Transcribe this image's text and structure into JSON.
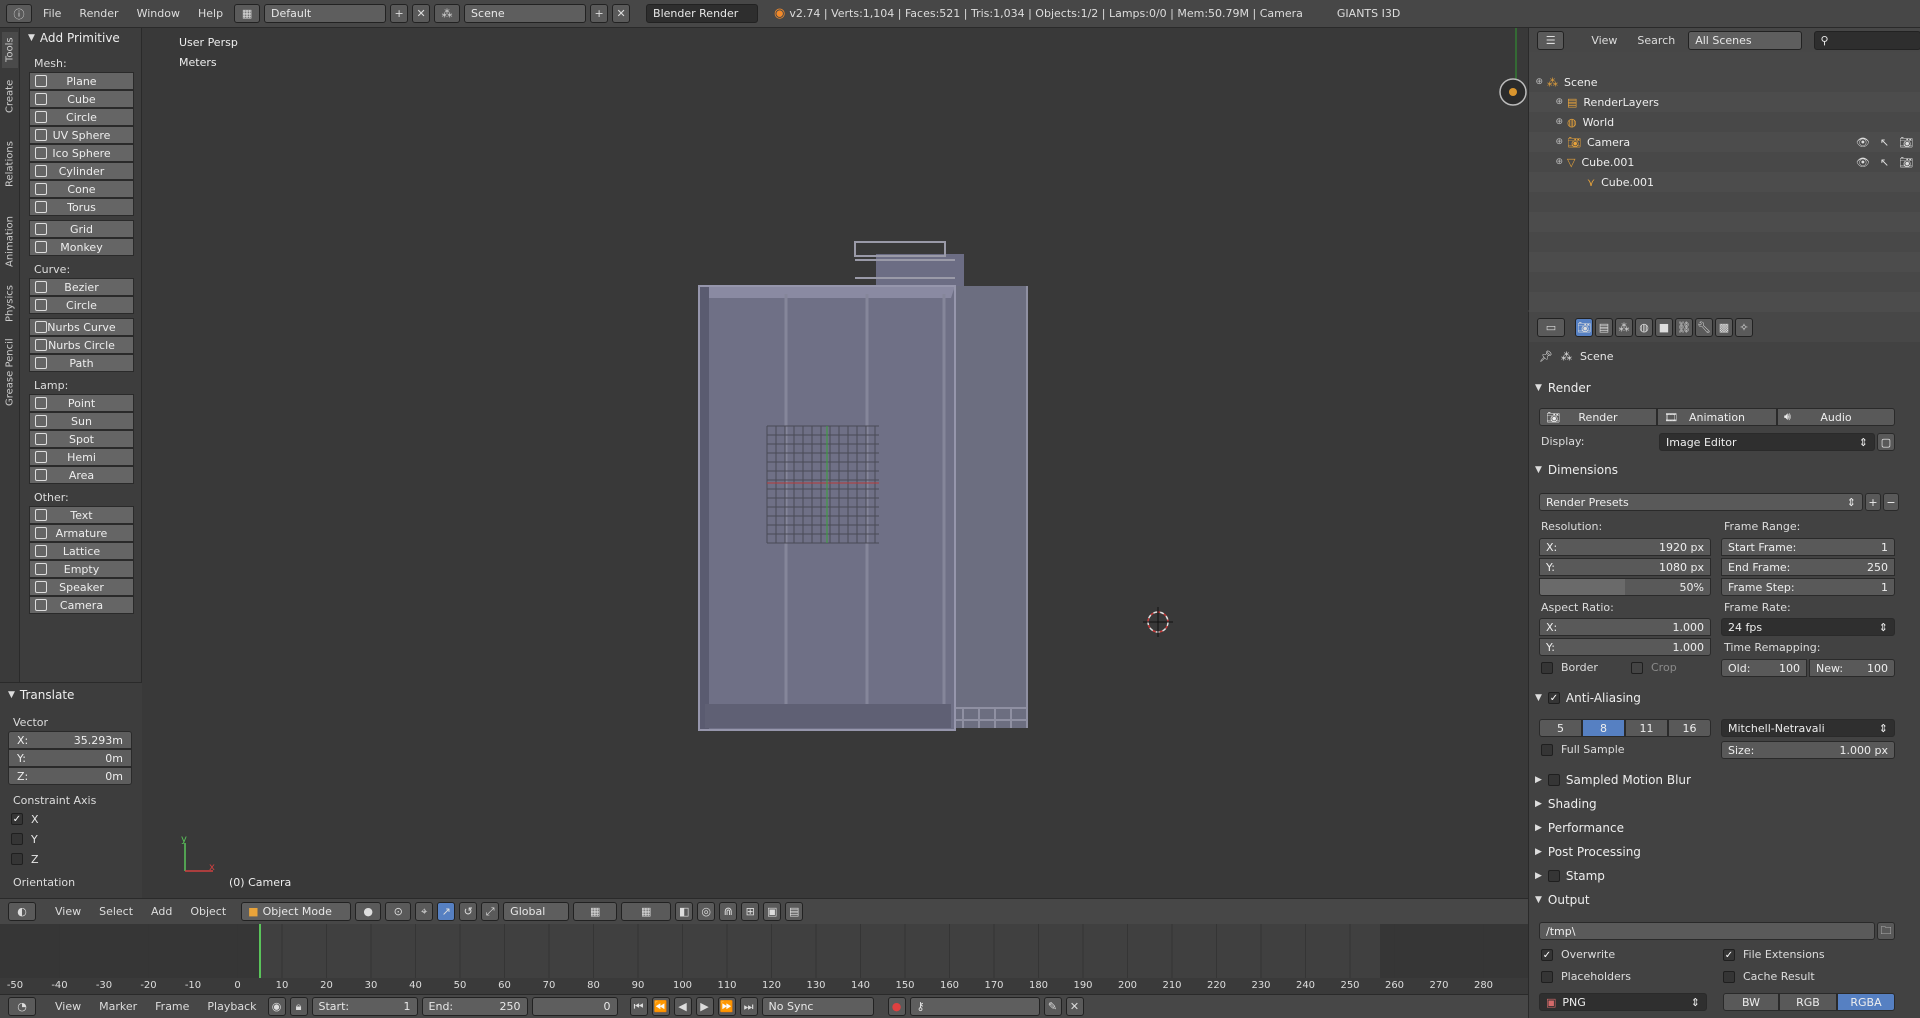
{
  "topbar": {
    "menus": [
      "File",
      "Render",
      "Window",
      "Help"
    ],
    "layout": "Default",
    "scene": "Scene",
    "engine": "Blender Render",
    "stats": "v2.74 | Verts:1,104 | Faces:521 | Tris:1,034 | Objects:1/2 | Lamps:0/0 | Mem:50.79M | Camera",
    "addon": "GIANTS I3D"
  },
  "tabs": [
    "Tools",
    "Create",
    "Relations",
    "Animation",
    "Physics",
    "Grease Pencil"
  ],
  "toolshelf": {
    "title": "Add Primitive",
    "mesh_label": "Mesh:",
    "mesh": [
      "Plane",
      "Cube",
      "Circle",
      "UV Sphere",
      "Ico Sphere",
      "Cylinder",
      "Cone",
      "Torus"
    ],
    "mesh2": [
      "Grid",
      "Monkey"
    ],
    "curve_label": "Curve:",
    "curve": [
      "Bezier",
      "Circle"
    ],
    "curve2": [
      "Nurbs Curve",
      "Nurbs Circle",
      "Path"
    ],
    "lamp_label": "Lamp:",
    "lamp": [
      "Point",
      "Sun",
      "Spot",
      "Hemi",
      "Area"
    ],
    "other_label": "Other:",
    "other": [
      "Text",
      "Armature",
      "Lattice",
      "Empty",
      "Speaker",
      "Camera"
    ]
  },
  "operator": {
    "title": "Translate",
    "vector_label": "Vector",
    "x_label": "X:",
    "x": "35.293m",
    "y_label": "Y:",
    "y": "0m",
    "z_label": "Z:",
    "z": "0m",
    "constraint_label": "Constraint Axis",
    "cx": "X",
    "cy": "Y",
    "cz": "Z",
    "orientation_label": "Orientation"
  },
  "viewport": {
    "persp": "User Persp",
    "units": "Meters",
    "object": "(0) Camera"
  },
  "vheader": {
    "menus": [
      "View",
      "Select",
      "Add",
      "Object"
    ],
    "mode": "Object Mode",
    "orientation": "Global"
  },
  "timeline": {
    "ticks": [
      "-50",
      "-40",
      "-30",
      "-20",
      "-10",
      "0",
      "10",
      "20",
      "30",
      "40",
      "50",
      "60",
      "70",
      "80",
      "90",
      "100",
      "110",
      "120",
      "130",
      "140",
      "150",
      "160",
      "170",
      "180",
      "190",
      "200",
      "210",
      "220",
      "230",
      "240",
      "250",
      "260",
      "270",
      "280"
    ],
    "menus": [
      "View",
      "Marker",
      "Frame",
      "Playback"
    ],
    "start": "Start:",
    "start_val": "1",
    "end": "End:",
    "end_val": "250",
    "current": "0",
    "sync": "No Sync"
  },
  "outliner": {
    "menus": [
      "View",
      "Search"
    ],
    "filter": "All Scenes",
    "items": [
      "Scene",
      "RenderLayers",
      "World",
      "Camera",
      "Cube.001",
      "Cube.001"
    ]
  },
  "props": {
    "context": "Scene",
    "render_section": "Render",
    "render_btn": "Render",
    "animation_btn": "Animation",
    "audio_btn": "Audio",
    "display_label": "Display:",
    "display": "Image Editor",
    "dimensions": "Dimensions",
    "presets": "Render Presets",
    "resolution_label": "Resolution:",
    "res_x_label": "X:",
    "res_x": "1920 px",
    "res_y_label": "Y:",
    "res_y": "1080 px",
    "res_pct": "50%",
    "frame_range_label": "Frame Range:",
    "start_frame_label": "Start Frame:",
    "start_frame": "1",
    "end_frame_label": "End Frame:",
    "end_frame": "250",
    "frame_step_label": "Frame Step:",
    "frame_step": "1",
    "aspect_label": "Aspect Ratio:",
    "asp_x_label": "X:",
    "asp_x": "1.000",
    "asp_y_label": "Y:",
    "asp_y": "1.000",
    "frame_rate_label": "Frame Rate:",
    "frame_rate": "24 fps",
    "remap_label": "Time Remapping:",
    "border": "Border",
    "crop": "Crop",
    "old_label": "Old:",
    "old": "100",
    "new_label": "New:",
    "new": "100",
    "aa": "Anti-Aliasing",
    "aa_samples": [
      "5",
      "8",
      "11",
      "16"
    ],
    "aa_filter": "Mitchell-Netravali",
    "full_sample": "Full Sample",
    "size_label": "Size:",
    "size": "1.000 px",
    "motion_blur": "Sampled Motion Blur",
    "shading": "Shading",
    "performance": "Performance",
    "post": "Post Processing",
    "stamp": "Stamp",
    "output": "Output",
    "path": "/tmp\\",
    "overwrite": "Overwrite",
    "file_ext": "File Extensions",
    "placeholders": "Placeholders",
    "cache": "Cache Result",
    "format": "PNG",
    "bw": "BW",
    "rgb": "RGB",
    "rgba": "RGBA"
  }
}
